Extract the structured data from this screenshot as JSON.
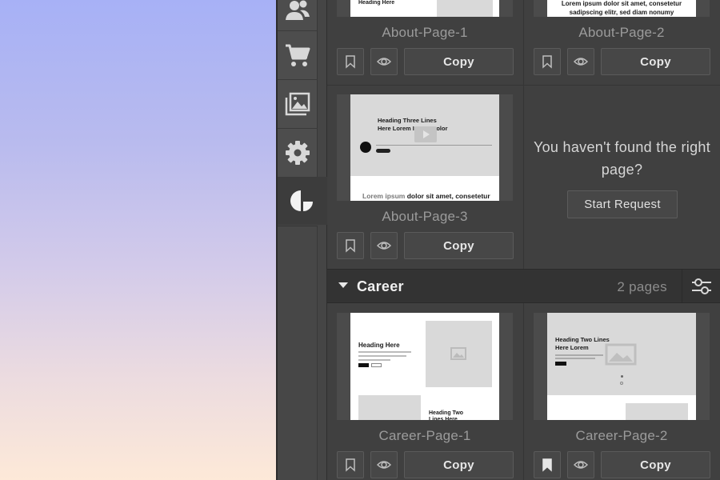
{
  "rail": {
    "items": [
      {
        "icon": "users-icon"
      },
      {
        "icon": "cart-icon"
      },
      {
        "icon": "images-icon"
      },
      {
        "icon": "gear-icon"
      },
      {
        "icon": "pie-chart-icon"
      }
    ]
  },
  "about": {
    "cards": [
      {
        "name": "About-Page-1",
        "copy": "Copy",
        "thumb_heading": "Heading Here"
      },
      {
        "name": "About-Page-2",
        "copy": "Copy",
        "thumb_line1": "Lorem ipsum dolor sit amet, consetetur",
        "thumb_line2": "sadipscing elitr, sed diam nonumy"
      },
      {
        "name": "About-Page-3",
        "copy": "Copy",
        "thumb_heading": "Heading Three Lines Here Lorem Ipsum Dolor",
        "thumb_footer_a": "Lorem ipsum",
        "thumb_footer_b": " dolor sit amet, consetetur"
      }
    ]
  },
  "request": {
    "text": "You haven't found the right page?",
    "button": "Start Request"
  },
  "career": {
    "title": "Career",
    "count": "2 pages",
    "cards": [
      {
        "name": "Career-Page-1",
        "copy": "Copy",
        "thumb_heading": "Heading Here",
        "thumb_heading2": "Heading Two Lines Here"
      },
      {
        "name": "Career-Page-2",
        "copy": "Copy",
        "thumb_heading": "Heading Two Lines Here Lorem",
        "bookmarked": true
      }
    ]
  }
}
